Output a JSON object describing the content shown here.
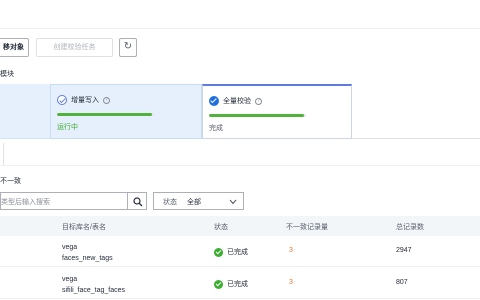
{
  "toolbar": {
    "migrate_label": "移对象",
    "create_task_label": "创建校验任务",
    "refresh_icon": "refresh-icon"
  },
  "section": {
    "label": "模块"
  },
  "steps": [
    {
      "name": "增量写入",
      "status": "运行中",
      "progress": 0.98,
      "icon": "check-circle-outline-icon"
    },
    {
      "name": "全量校验",
      "status": "完成",
      "progress": 0.98,
      "icon": "check-circle-filled-icon"
    }
  ],
  "filter": {
    "label": "不一致",
    "search_placeholder": "类型后输入搜索",
    "status_key": "状态",
    "status_value": "全部"
  },
  "table": {
    "headers": [
      "目标库名/表名",
      "状态",
      "不一致记录量",
      "总记录数"
    ],
    "rows": [
      {
        "db": "vega",
        "table": "faces_new_tags",
        "status": "已完成",
        "inconsistent": "3",
        "total": "2947"
      },
      {
        "db": "vega",
        "table": "sifili_face_tag_faces",
        "status": "已完成",
        "inconsistent": "3",
        "total": "807"
      }
    ]
  },
  "colors": {
    "accent": "#5e7ce0",
    "success": "#3bad2f",
    "warning": "#e6772e",
    "step_bg": "#e5f0fc"
  }
}
